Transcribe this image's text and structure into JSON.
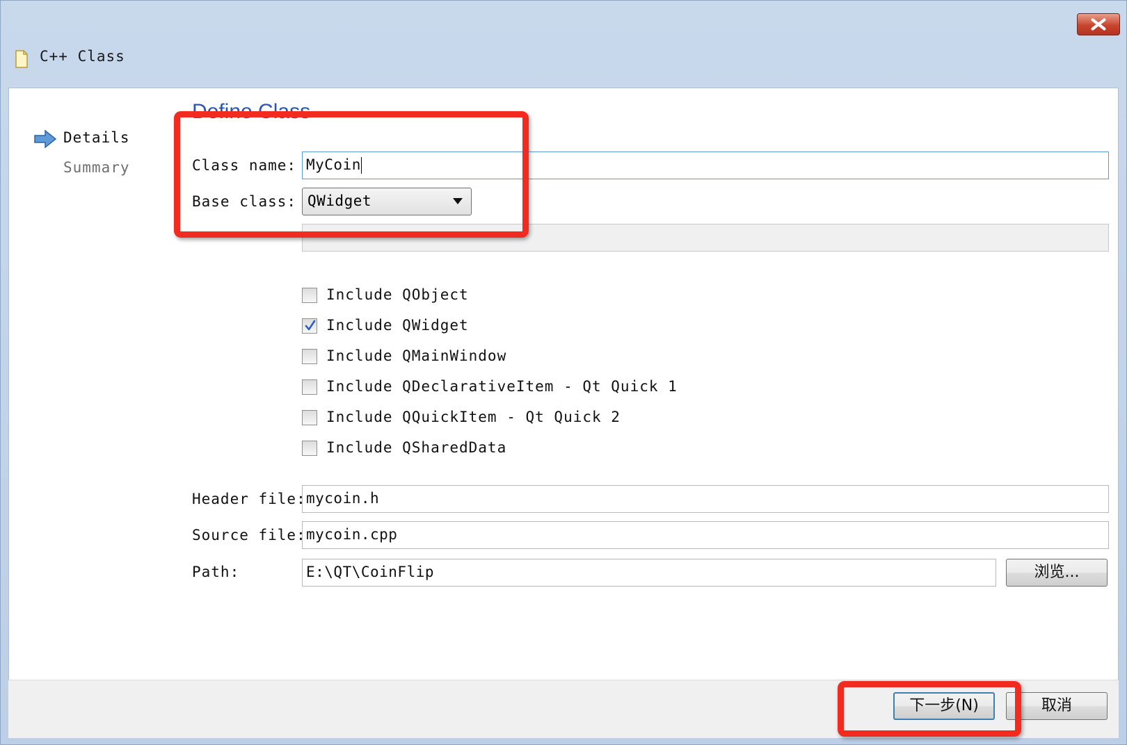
{
  "window": {
    "title": "C++ Class",
    "close_icon": "close-icon",
    "title_icon": "document-icon"
  },
  "sidebar": {
    "items": [
      {
        "label": "Details",
        "active": true,
        "icon": "right-arrow-icon"
      },
      {
        "label": "Summary",
        "active": false
      }
    ]
  },
  "page": {
    "heading": "Define Class"
  },
  "form": {
    "class_name_label": "Class name:",
    "class_name_value": "MyCoin",
    "base_class_label": "Base class:",
    "base_class_value": "QWidget",
    "checkboxes": [
      {
        "label": "Include QObject",
        "checked": false
      },
      {
        "label": "Include QWidget",
        "checked": true
      },
      {
        "label": "Include QMainWindow",
        "checked": false
      },
      {
        "label": "Include QDeclarativeItem - Qt Quick 1",
        "checked": false
      },
      {
        "label": "Include QQuickItem - Qt Quick 2",
        "checked": false
      },
      {
        "label": "Include QSharedData",
        "checked": false
      }
    ],
    "header_file_label": "Header file:",
    "header_file_value": "mycoin.h",
    "source_file_label": "Source file:",
    "source_file_value": "mycoin.cpp",
    "path_label": "Path:",
    "path_value": "E:\\QT\\CoinFlip",
    "browse_label": "浏览..."
  },
  "footer": {
    "next_label": "下一步(N)",
    "cancel_label": "取消"
  },
  "colors": {
    "annotation": "#f22b20",
    "heading": "#2857b8",
    "titlebar": "#c9d9ec"
  }
}
